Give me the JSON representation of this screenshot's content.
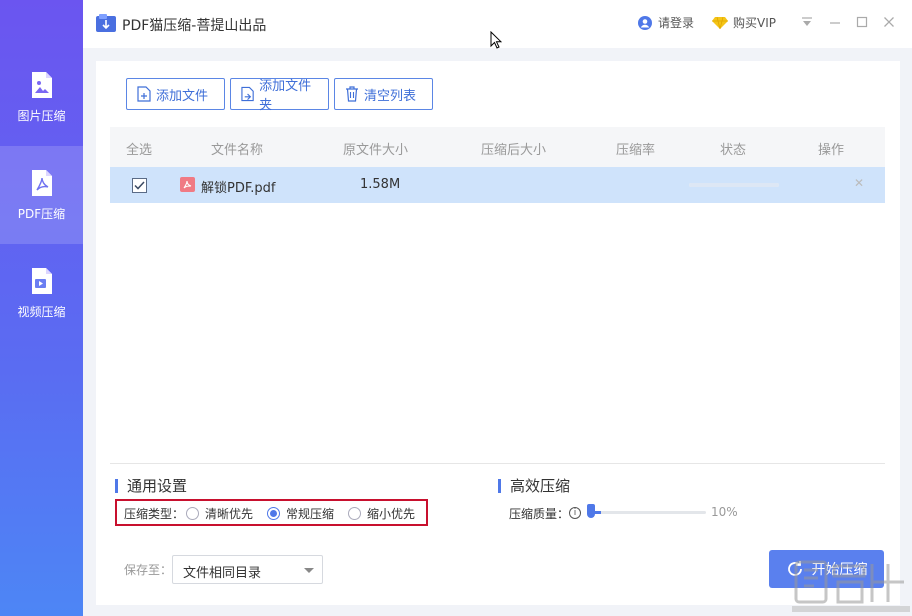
{
  "app": {
    "title": "PDF猫压缩-菩提山出品"
  },
  "header": {
    "login_label": "请登录",
    "vip_label": "购买VIP"
  },
  "sidebar": {
    "items": [
      {
        "label": "图片压缩",
        "icon": "image-file-icon"
      },
      {
        "label": "PDF压缩",
        "icon": "pdf-file-icon"
      },
      {
        "label": "视频压缩",
        "icon": "video-file-icon"
      }
    ]
  },
  "toolbar": {
    "add_file": "添加文件",
    "add_folder": "添加文件夹",
    "clear_list": "清空列表"
  },
  "table": {
    "headers": [
      "全选",
      "文件名称",
      "原文件大小",
      "压缩后大小",
      "压缩率",
      "状态",
      "操作"
    ],
    "rows": [
      {
        "name": "解锁PDF.pdf",
        "size": "1.58M",
        "compressed_size": "",
        "ratio": "",
        "checked": true
      }
    ]
  },
  "settings": {
    "general_title": "通用设置",
    "compress_type_label": "压缩类型：",
    "options": [
      "清晰优先",
      "常规压缩",
      "缩小优先"
    ],
    "selected_option": "常规压缩",
    "efficient_title": "高效压缩",
    "quality_label": "压缩质量：",
    "quality_value": "10%"
  },
  "footer": {
    "save_label": "保存至：",
    "save_option": "文件相同目录",
    "start_label": "开始压缩"
  },
  "colors": {
    "accent": "#4f78e8",
    "sidebar_top": "#6b55f0",
    "sidebar_bottom": "#4d86f5",
    "highlight_box": "#c8102e"
  }
}
